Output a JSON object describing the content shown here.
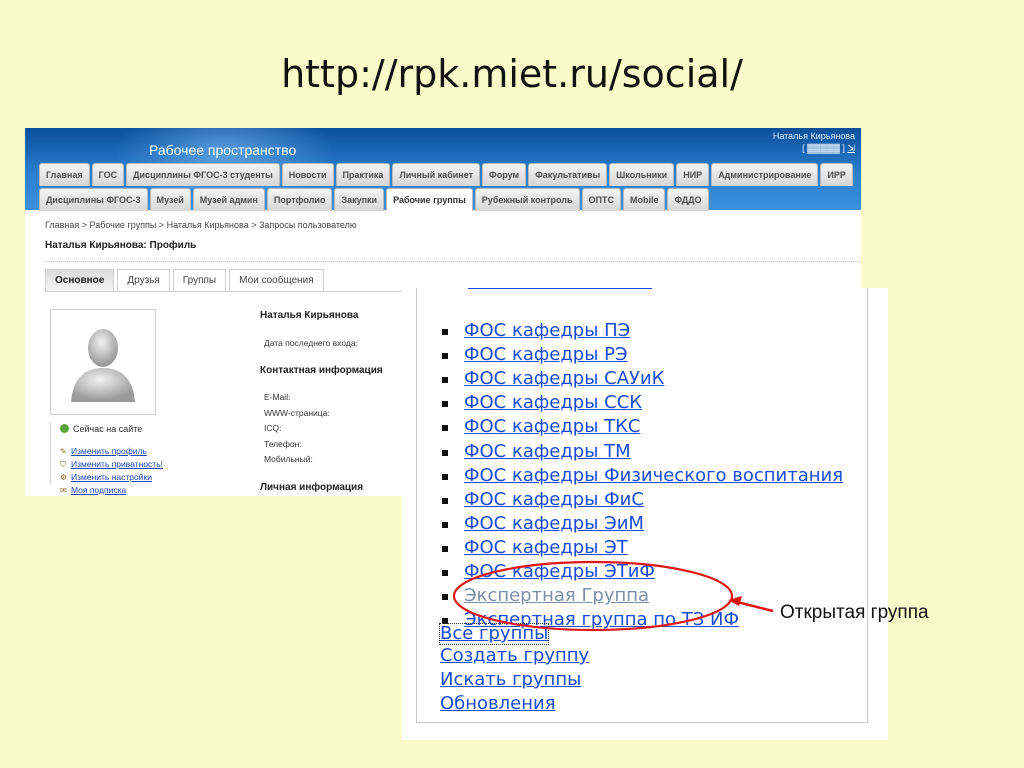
{
  "slide": {
    "title": "http://rpk.miet.ru/social/",
    "callout": "Открытая группа"
  },
  "portal": {
    "name": "Рабочее пространство",
    "user_name": "Наталья Кирьянова",
    "user_login": "[ ▓▓▓▓▓ ]",
    "logout": "⇲",
    "tabs_row1": [
      "Главная",
      "ГОС",
      "Дисциплины ФГОС-3 студенты",
      "Новости",
      "Практика",
      "Личный кабинет",
      "Форум",
      "Факультативы",
      "Школьники",
      "НИР",
      "Администрирование",
      "ИРР"
    ],
    "tabs_row2": [
      "Дисциплины ФГОС-3",
      "Музей",
      "Музей админ",
      "Портфолио",
      "Закупки",
      "Рабочие группы",
      "Рубежный контроль",
      "ОПТС",
      "Mobile",
      "ФДДО"
    ],
    "breadcrumb": "Главная > Рабочие группы > Наталья Кирьянова > Запросы пользователю",
    "profile_title": "Наталья Кирьянова: Профиль",
    "profile_tabs": [
      "Основное",
      "Друзья",
      "Группы",
      "Мои сообщения"
    ],
    "status": "Сейчас на сайте",
    "links": [
      "Изменить профиль",
      "Изменить приватность!",
      "Изменить настройки",
      "Моя подписка"
    ],
    "info_name": "Наталья Кирьянова",
    "last_login": "Дата последнего входа:",
    "contact_heading": "Контактная информация",
    "contacts": [
      "E-Mail:",
      "WWW-страница:",
      "ICQ:",
      "Телефон:",
      "Мобильный:"
    ],
    "personal_heading": "Личная информация"
  },
  "groups": {
    "items": [
      "ФОС кафедры ПЭ",
      "ФОС кафедры РЭ",
      "ФОС кафедры САУиК",
      "ФОС кафедры ССК",
      "ФОС кафедры ТКС",
      "ФОС кафедры ТМ",
      "ФОС кафедры Физического воспитания",
      "ФОС кафедры ФиС",
      "ФОС кафедры ЭиМ",
      "ФОС кафедры ЭТ",
      "ФОС кафедры ЭТиФ",
      "Экспертная Группа",
      "Экспертная группа по ТЗ ИФ"
    ],
    "actions": [
      "Все группы",
      "Создать группу",
      "Искать группы",
      "Обновления"
    ]
  }
}
